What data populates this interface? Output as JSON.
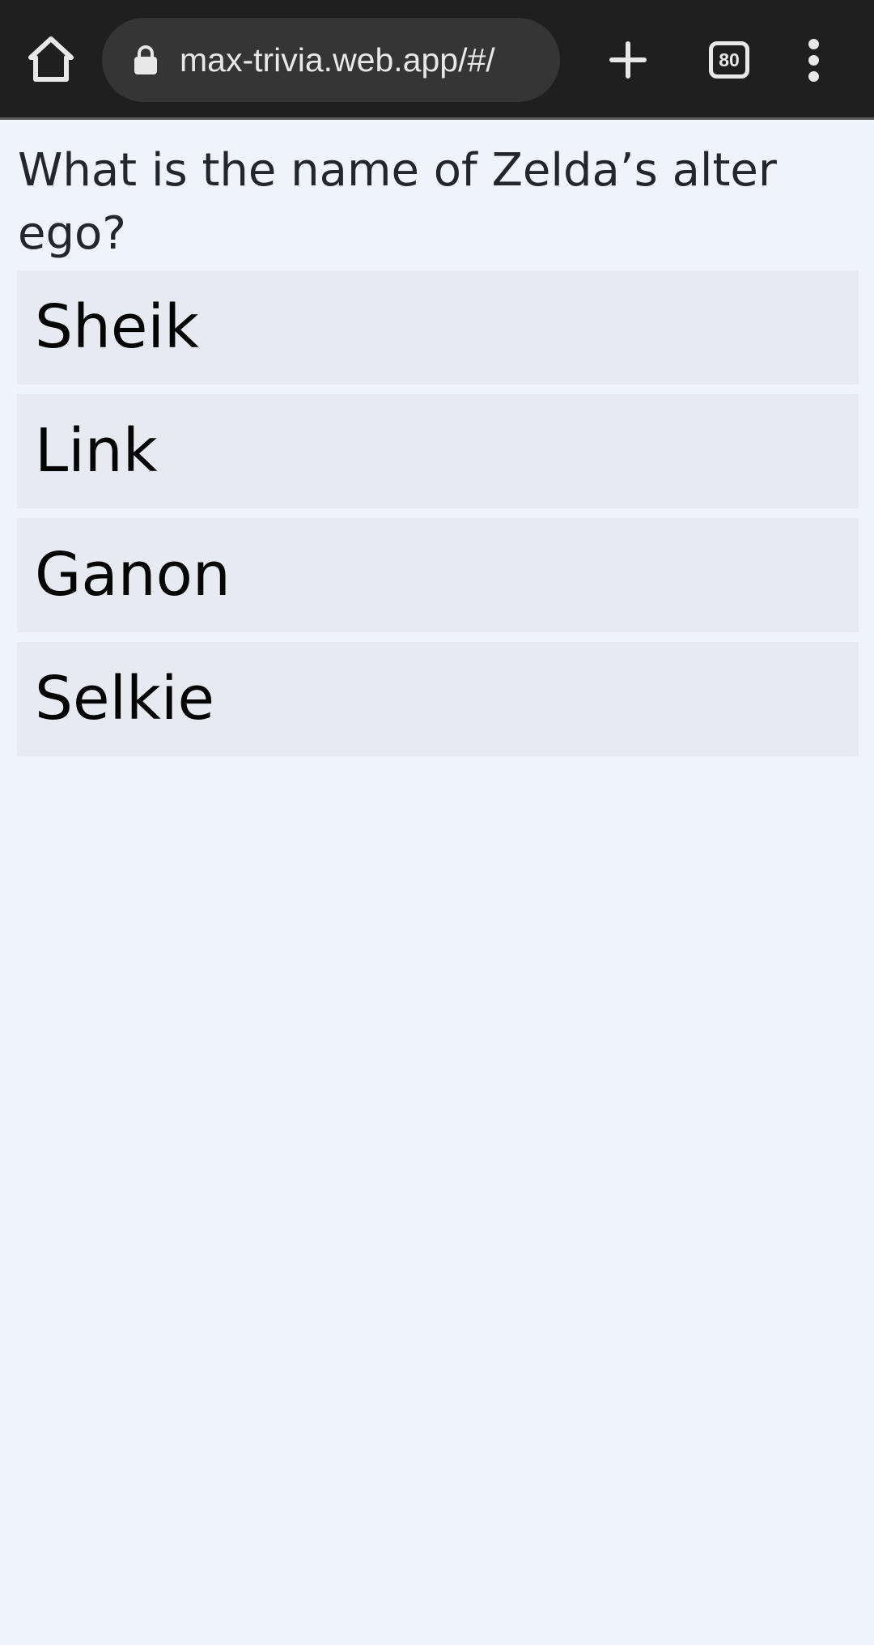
{
  "browser": {
    "home_icon": "home-icon",
    "lock_icon": "lock-icon",
    "url": "max-trivia.web.app/#/",
    "new_tab_icon": "plus-icon",
    "tab_count": "80",
    "menu_icon": "more-vert-icon",
    "toolbar_color": "#1f1f1f",
    "omnibox_color": "#353535"
  },
  "quiz": {
    "question": "What is the name of Zelda’s alter ego?",
    "answers": [
      {
        "label": "Sheik"
      },
      {
        "label": "Link"
      },
      {
        "label": "Ganon"
      },
      {
        "label": "Selkie"
      }
    ],
    "background_color": "#eff3fa",
    "answer_color": "#e7eaf0"
  }
}
